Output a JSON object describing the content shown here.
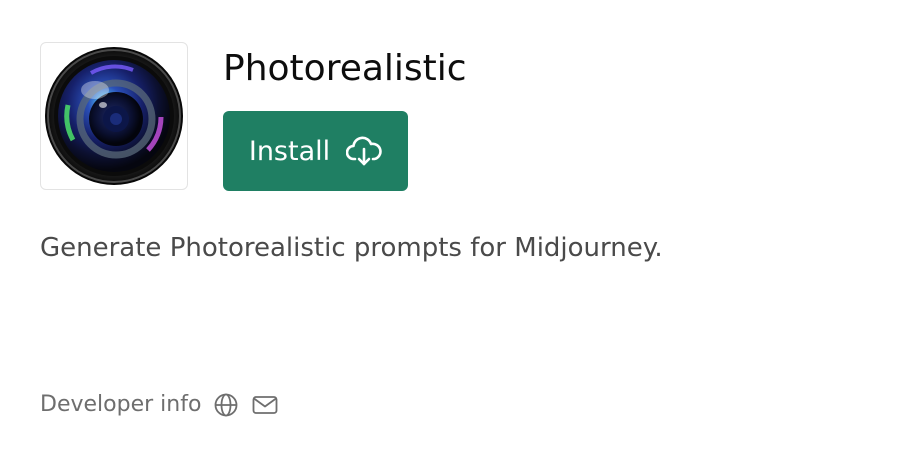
{
  "app": {
    "title": "Photorealistic",
    "icon": "camera-lens-icon",
    "description": "Generate Photorealistic prompts for Midjourney."
  },
  "install": {
    "label": "Install",
    "icon": "cloud-download-icon",
    "color": "#1f7f63"
  },
  "developer": {
    "label": "Developer info",
    "icons": [
      "globe-icon",
      "mail-icon"
    ]
  }
}
